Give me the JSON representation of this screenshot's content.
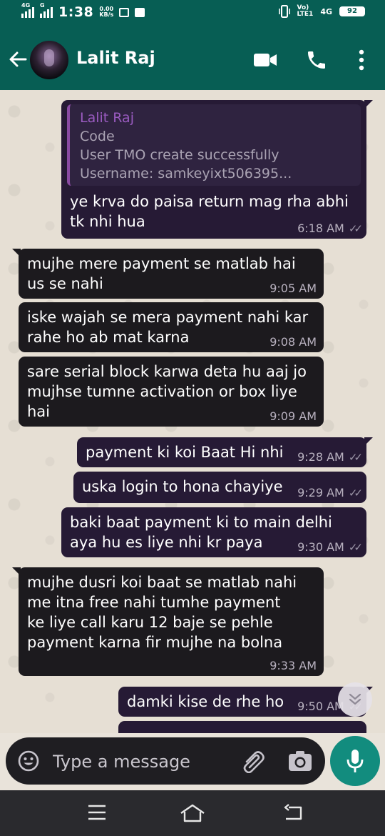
{
  "status_bar": {
    "sim1_label": "4G",
    "sim2_label": "G",
    "time": "1:38",
    "speed_value": "0.00",
    "speed_unit": "KB/s",
    "volte_top": "Vo)",
    "volte_bottom": "LTE1",
    "network": "4G",
    "battery": "92"
  },
  "header": {
    "contact_name": "Lalit Raj"
  },
  "messages": [
    {
      "dir": "out",
      "quote": {
        "name": "Lalit Raj",
        "lines": [
          "Code",
          "User TMO create successfully",
          "Username: samkeyixt506395..."
        ]
      },
      "text": "ye krva do paisa return mag rha abhi tk nhi hua",
      "time": "6:18 AM",
      "ticks": "✓✓"
    },
    {
      "dir": "in",
      "text": "mujhe mere payment se matlab hai us se nahi",
      "time": "9:05 AM"
    },
    {
      "dir": "in",
      "text": "iske wajah se mera payment nahi kar rahe ho ab mat karna",
      "time": "9:08 AM"
    },
    {
      "dir": "in",
      "text": "sare serial block karwa deta hu aaj jo mujhse tumne activation or box liye hai",
      "time": "9:09 AM"
    },
    {
      "dir": "out",
      "text": "payment ki koi Baat Hi nhi",
      "time": "9:28 AM",
      "ticks": "✓✓"
    },
    {
      "dir": "out",
      "text": "uska login to hona chayiye",
      "time": "9:29 AM",
      "ticks": "✓✓"
    },
    {
      "dir": "out",
      "text": "baki baat payment ki to main delhi aya hu es liye nhi kr paya",
      "time": "9:30 AM",
      "ticks": "✓✓"
    },
    {
      "dir": "in",
      "text": "mujhe dusri koi baat se matlab nahi me itna free nahi tumhe payment ke liye call karu 12 baje se pehle payment karna fir mujhe na bolna",
      "time": "9:33 AM"
    },
    {
      "dir": "out",
      "text": "damki kise de rhe ho",
      "time": "9:50 AM",
      "ticks": "✓✓"
    }
  ],
  "composer": {
    "placeholder": "Type a message"
  },
  "icons": {
    "back": "arrow-left-icon",
    "video": "video-call-icon",
    "call": "phone-icon",
    "menu": "more-vert-icon",
    "emoji": "emoji-icon",
    "attach": "paperclip-icon",
    "camera": "camera-icon",
    "mic": "mic-icon"
  },
  "colors": {
    "header": "#075e54",
    "outgoing_bubble": "#261a35",
    "incoming_bubble": "#1c1a1e",
    "mic_button": "#128c7e",
    "quote_accent": "#8a4aa3"
  }
}
